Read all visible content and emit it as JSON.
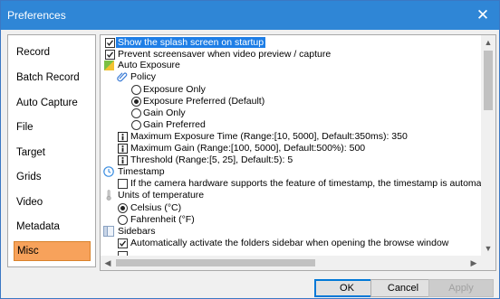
{
  "window": {
    "title": "Preferences",
    "close_glyph": "✕"
  },
  "nav": {
    "items": [
      {
        "label": "Record"
      },
      {
        "label": "Batch Record"
      },
      {
        "label": "Auto Capture"
      },
      {
        "label": "File"
      },
      {
        "label": "Target"
      },
      {
        "label": "Grids"
      },
      {
        "label": "Video"
      },
      {
        "label": "Metadata"
      },
      {
        "label": "Misc"
      }
    ],
    "selected": "Misc"
  },
  "options": {
    "splash": {
      "label": "Show the splash screen on startup",
      "checked": true
    },
    "screensaver": {
      "label": "Prevent screensaver when video preview / capture",
      "checked": true
    },
    "auto_exposure": {
      "label": "Auto Exposure"
    },
    "policy": {
      "label": "Policy",
      "options": [
        "Exposure Only",
        "Exposure Preferred (Default)",
        "Gain Only",
        "Gain Preferred"
      ],
      "selected": "Exposure Preferred (Default)"
    },
    "max_exposure": {
      "label": "Maximum Exposure Time (Range:[10, 5000], Default:350ms): 350"
    },
    "max_gain": {
      "label": "Maximum Gain (Range:[100, 5000], Default:500%): 500"
    },
    "threshold": {
      "label": "Threshold (Range:[5, 25], Default:5): 5"
    },
    "timestamp": {
      "label": "Timestamp",
      "option": {
        "label": "If the camera hardware supports the feature of timestamp, the timestamp is automatically logged",
        "checked": false
      }
    },
    "temperature": {
      "label": "Units of temperature",
      "options": [
        "Celsius (°C)",
        "Fahrenheit (°F)"
      ],
      "selected": "Celsius (°C)"
    },
    "sidebars": {
      "label": "Sidebars",
      "option": {
        "label": "Automatically activate the folders sidebar when opening the browse window",
        "checked": true
      }
    }
  },
  "buttons": {
    "ok": "OK",
    "cancel": "Cancel",
    "apply": "Apply"
  },
  "colors": {
    "titlebar": "#2f86d6",
    "selection": "#1e7ee6",
    "nav_active": "#f7a25b"
  }
}
